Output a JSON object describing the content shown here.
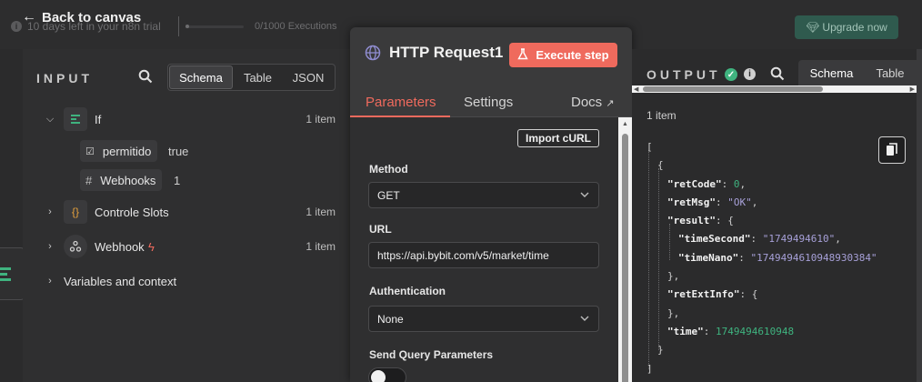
{
  "topbar": {
    "back_label": "Back to canvas",
    "trial_text": "10 days left in your n8n trial",
    "executions_text": "0/1000 Executions",
    "upgrade_label": "Upgrade now"
  },
  "input_panel": {
    "title": "INPUT",
    "view_tabs": [
      "Schema",
      "Table",
      "JSON"
    ],
    "active_tab": "Schema",
    "nodes": [
      {
        "label": "If",
        "count": "1 item",
        "icon": "if-node-icon",
        "expanded": true
      },
      {
        "label": "Controle Slots",
        "count": "1 item",
        "icon": "code-braces-icon"
      },
      {
        "label": "Webhook",
        "count": "1 item",
        "icon": "webhook-icon"
      }
    ],
    "fields": [
      {
        "name": "permitido",
        "value": "true",
        "icon": "checkbox-icon"
      },
      {
        "name": "Webhooks",
        "value": "1",
        "icon": "hash-icon"
      }
    ],
    "variables_label": "Variables and context"
  },
  "http_panel": {
    "title": "HTTP Request1",
    "execute_label": "Execute step",
    "tabs": [
      "Parameters",
      "Settings",
      "Docs"
    ],
    "active_tab": "Parameters",
    "import_label": "Import cURL",
    "method_label": "Method",
    "method_value": "GET",
    "url_label": "URL",
    "url_value": "https://api.bybit.com/v5/market/time",
    "auth_label": "Authentication",
    "auth_value": "None",
    "query_label": "Send Query Parameters"
  },
  "output_panel": {
    "title": "OUTPUT",
    "view_tabs": [
      "Schema",
      "Table"
    ],
    "active_tab": "Schema",
    "items_label": "1 item",
    "json": {
      "open_array": "[",
      "open_obj": "{",
      "retCode_key": "\"retCode\"",
      "retCode_val": "0",
      "retMsg_key": "\"retMsg\"",
      "retMsg_val": "\"OK\"",
      "result_key": "\"result\"",
      "timeSecond_key": "\"timeSecond\"",
      "timeSecond_val": "\"1749494610\"",
      "timeNano_key": "\"timeNano\"",
      "timeNano_val": "\"1749494610948930384\"",
      "retExtInfo_key": "\"retExtInfo\"",
      "time_key": "\"time\"",
      "time_val": "1749494610948",
      "close_obj": "}",
      "close_array": "]"
    }
  },
  "colors": {
    "accent": "#ef6a5d",
    "success": "#3fb37f",
    "json_string": "#a7a0d8",
    "panel_bg": "#2f2f30"
  }
}
